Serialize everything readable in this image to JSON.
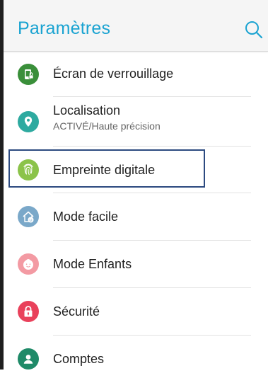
{
  "header": {
    "title": "Paramètres",
    "search_icon": "search-icon"
  },
  "colors": {
    "accent": "#1aa3d1",
    "lock": "#3a8f3a",
    "location": "#2eaaa0",
    "fingerprint": "#8bc34a",
    "easy_mode": "#7aa8c9",
    "kids_mode": "#f39aa3",
    "security": "#e9415b",
    "accounts": "#1f8a68",
    "highlight_border": "#2c4a80"
  },
  "items": [
    {
      "label": "Écran de verrouillage",
      "icon": "lock-screen-icon"
    },
    {
      "label": "Localisation",
      "subtitle": "ACTIVÉ/Haute précision",
      "icon": "location-icon"
    },
    {
      "label": "Empreinte digitale",
      "icon": "fingerprint-icon"
    },
    {
      "label": "Mode facile",
      "icon": "easy-mode-icon"
    },
    {
      "label": "Mode Enfants",
      "icon": "kids-mode-icon"
    },
    {
      "label": "Sécurité",
      "icon": "security-lock-icon"
    },
    {
      "label": "Comptes",
      "icon": "accounts-icon"
    }
  ]
}
